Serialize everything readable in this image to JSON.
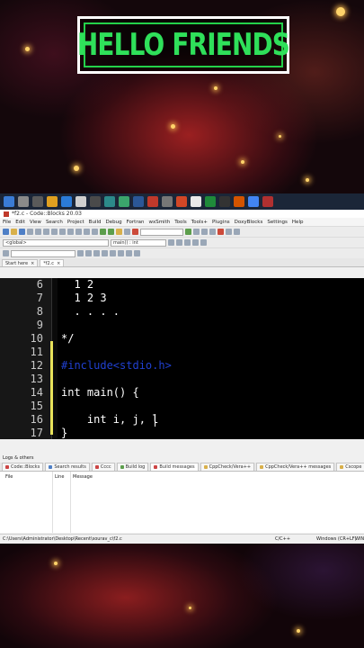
{
  "overlay": {
    "title": "HELLO FRIENDS"
  },
  "window": {
    "title": "*f2.c - Code::Blocks 20.03"
  },
  "menu": [
    "File",
    "Edit",
    "View",
    "Search",
    "Project",
    "Build",
    "Debug",
    "Fortran",
    "wxSmith",
    "Tools",
    "Tools+",
    "Plugins",
    "DoxyBlocks",
    "Settings",
    "Help"
  ],
  "toolbar": {
    "scope_combo": "<global>",
    "function_combo": "main() : int"
  },
  "editor_tabs": [
    {
      "label": "Start here"
    },
    {
      "label": "*f2.c"
    }
  ],
  "code_lines": [
    {
      "num": "6",
      "text": "  1 2",
      "kind": "comment"
    },
    {
      "num": "7",
      "text": "  1 2 3",
      "kind": "comment"
    },
    {
      "num": "8",
      "text": "  . . . .",
      "kind": "comment"
    },
    {
      "num": "9",
      "text": "",
      "kind": "comment"
    },
    {
      "num": "10",
      "text": "*/",
      "kind": "comment"
    },
    {
      "num": "11",
      "text": "",
      "kind": "blank"
    },
    {
      "num": "12",
      "text": "#include<stdio.h>",
      "kind": "preprocessor"
    },
    {
      "num": "13",
      "text": "",
      "kind": "blank"
    },
    {
      "num": "14",
      "text": "int main() {",
      "kind": "code"
    },
    {
      "num": "15",
      "text": "",
      "kind": "blank"
    },
    {
      "num": "16",
      "text": "    int i, j, l",
      "kind": "code"
    },
    {
      "num": "17",
      "text": "}",
      "kind": "code"
    }
  ],
  "logs": {
    "header": "Logs & others",
    "tabs": [
      {
        "label": "Code::Blocks",
        "active": false
      },
      {
        "label": "Search results",
        "active": false
      },
      {
        "label": "Cccc",
        "active": false
      },
      {
        "label": "Build log",
        "active": false
      },
      {
        "label": "Build messages",
        "active": true
      },
      {
        "label": "CppCheck/Vera++",
        "active": false
      },
      {
        "label": "CppCheck/Vera++ messages",
        "active": false
      },
      {
        "label": "Cscope",
        "active": false
      }
    ],
    "columns": [
      "File",
      "Line",
      "Message"
    ]
  },
  "status": {
    "path": "C:\\Users\\Administrator\\Desktop\\Recent\\sourav_c\\f2.c",
    "language": "C/C++",
    "line_endings": "Windows (CR+LF)",
    "encoding": "WINDO"
  },
  "colors": {
    "title_green": "#2fe05a",
    "preprocessor": "#2040d0",
    "editor_bg": "#000000",
    "change_marker": "#e8e25a"
  }
}
